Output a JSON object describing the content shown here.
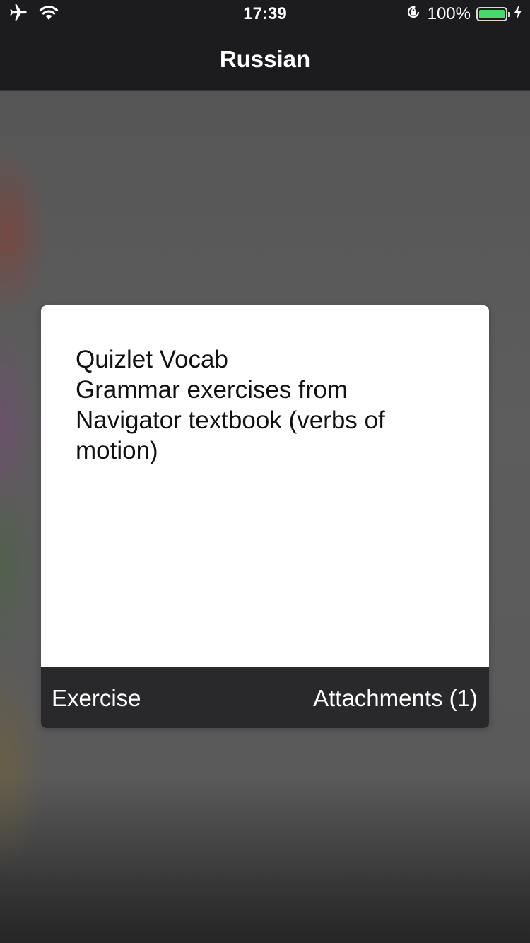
{
  "status_bar": {
    "time": "17:39",
    "battery_percent": "100%",
    "battery_level": 1.0,
    "icons": [
      "airplane-icon",
      "wifi-icon",
      "rotation-lock-icon",
      "battery-icon",
      "charging-icon"
    ]
  },
  "nav": {
    "title": "Russian"
  },
  "card": {
    "lines": [
      "Quizlet Vocab",
      "Grammar exercises from Navigator textbook (verbs of motion)"
    ],
    "footer": {
      "type_label": "Exercise",
      "attachments_label": "Attachments (1)"
    }
  },
  "colors": {
    "bar_background": "#1c1c1e",
    "card_footer": "#29292b",
    "battery_green": "#4cd964"
  }
}
